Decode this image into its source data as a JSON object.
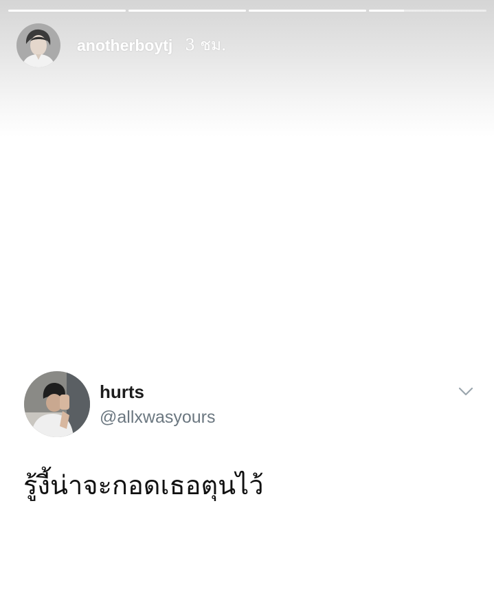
{
  "story": {
    "progress_segments": [
      1,
      1,
      1,
      0.3
    ],
    "username": "anotherboytj",
    "time": "3 ชม.",
    "avatar_icon": "person-photo-icon"
  },
  "tweet": {
    "display_name": "hurts",
    "handle": "@allxwasyours",
    "text": "รู้งี้น่าจะกอดเธอตุนไว้",
    "avatar_icon": "person-photo-icon",
    "menu_icon": "chevron-down-icon"
  },
  "colors": {
    "handle": "#6b7780",
    "chevron": "#9aa5ad",
    "progress_track": "rgba(255,255,255,0.55)",
    "progress_fill": "#ffffff"
  }
}
